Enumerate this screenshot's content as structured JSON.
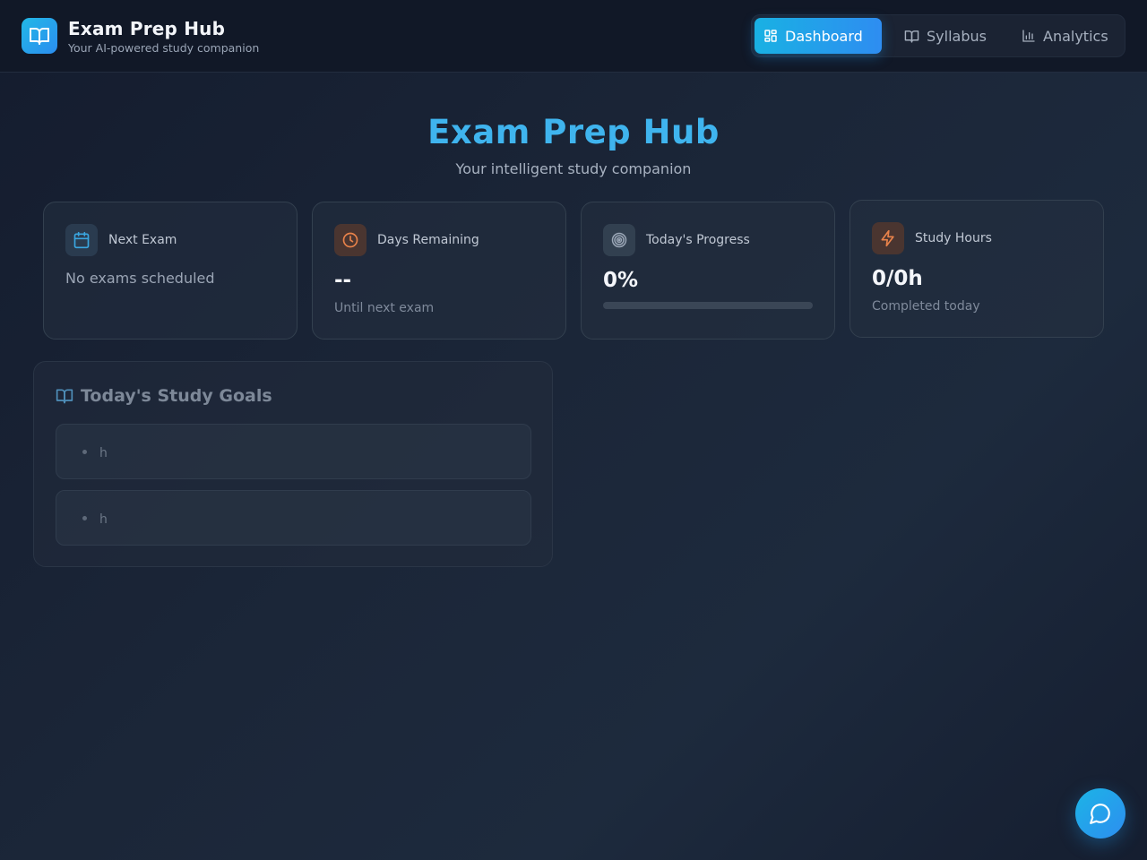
{
  "header": {
    "title": "Exam Prep Hub",
    "subtitle": "Your AI-powered study companion",
    "logo_icon": "open-book-icon"
  },
  "nav": {
    "tabs": [
      {
        "label": "Dashboard",
        "icon": "grid-icon",
        "active": true
      },
      {
        "label": "Syllabus",
        "icon": "book-icon",
        "active": false
      },
      {
        "label": "Analytics",
        "icon": "bar-chart-icon",
        "active": false
      }
    ]
  },
  "hero": {
    "title": "Exam Prep Hub",
    "subtitle": "Your intelligent study companion"
  },
  "stats": {
    "next_exam": {
      "label": "Next Exam",
      "empty_text": "No exams scheduled",
      "icon": "calendar-icon"
    },
    "days_remaining": {
      "label": "Days Remaining",
      "value": "--",
      "caption": "Until next exam",
      "icon": "clock-icon"
    },
    "todays_progress": {
      "label": "Today's Progress",
      "value": "0%",
      "progress": 0,
      "icon": "target-icon"
    },
    "study_hours": {
      "label": "Study Hours",
      "value": "0/0h",
      "caption": "Completed today",
      "icon": "lightning-icon"
    }
  },
  "goals": {
    "title": "Today's Study Goals",
    "icon": "book-icon",
    "items": [
      "h",
      "h"
    ]
  },
  "chat": {
    "icon": "chat-bubble-icon"
  },
  "colors": {
    "accent": "#2b9ded",
    "hero_title": "#3fb4ee",
    "orange_icon": "#e8824a",
    "blue_icon": "#3aa6e0"
  }
}
